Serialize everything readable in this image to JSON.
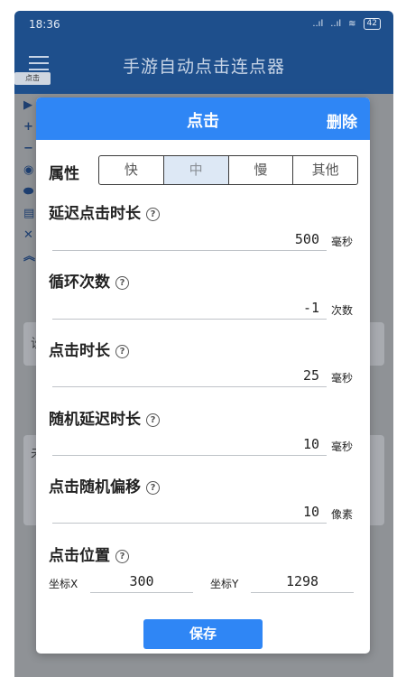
{
  "status_bar": {
    "time": "18:36",
    "signal1": "..ıl",
    "signal2": "..ıl",
    "wifi": "≋",
    "battery": "42"
  },
  "app_bar": {
    "title": "手游自动点击连点器",
    "tag": "点击"
  },
  "background": {
    "text1": "设",
    "text2": "未"
  },
  "dialog": {
    "title": "点击",
    "delete_label": "删除",
    "attribute": {
      "label": "属性",
      "options": [
        "快",
        "中",
        "慢",
        "其他"
      ],
      "selected": "中"
    },
    "fields": [
      {
        "label": "延迟点击时长",
        "value": "500",
        "unit": "毫秒"
      },
      {
        "label": "循环次数",
        "value": "-1",
        "unit": "次数"
      },
      {
        "label": "点击时长",
        "value": "25",
        "unit": "毫秒"
      },
      {
        "label": "随机延迟时长",
        "value": "10",
        "unit": "毫秒"
      },
      {
        "label": "点击随机偏移",
        "value": "10",
        "unit": "像素"
      }
    ],
    "position": {
      "label": "点击位置",
      "x_label": "坐标X",
      "x_value": "300",
      "y_label": "坐标Y",
      "y_value": "1298"
    },
    "save_label": "保存",
    "help_glyph": "?"
  },
  "colors": {
    "header_blue": "#2f86f5",
    "app_bar_blue": "#1e4f8c",
    "selected_segment": "#dde8f5"
  }
}
